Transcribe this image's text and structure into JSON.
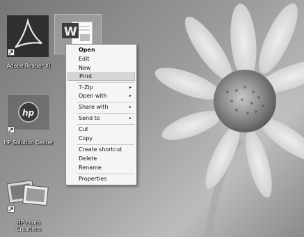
{
  "desktop": {
    "icons": [
      {
        "label": "Adobe Reader XI",
        "icon": "adobe-reader-icon"
      },
      {
        "label": "",
        "icon": "word-document-icon"
      },
      {
        "label": "HP Solution Center",
        "icon": "hp-logo-icon"
      },
      {
        "label": "HP Photo\nCreations",
        "icon": "hp-photo-creations-icon"
      }
    ]
  },
  "context_menu": {
    "items": [
      {
        "label": "Open",
        "bold": true
      },
      {
        "label": "Edit"
      },
      {
        "label": "New"
      },
      {
        "label": "Print",
        "highlighted": true
      },
      {
        "label": "7-Zip",
        "submenu": true
      },
      {
        "label": "Open with",
        "submenu": true
      },
      {
        "label": "Share with",
        "submenu": true
      },
      {
        "label": "Send to",
        "submenu": true
      },
      {
        "label": "Cut"
      },
      {
        "label": "Copy"
      },
      {
        "label": "Create shortcut"
      },
      {
        "label": "Delete"
      },
      {
        "label": "Rename"
      },
      {
        "label": "Properties"
      }
    ],
    "submenu_glyph": "▸"
  }
}
